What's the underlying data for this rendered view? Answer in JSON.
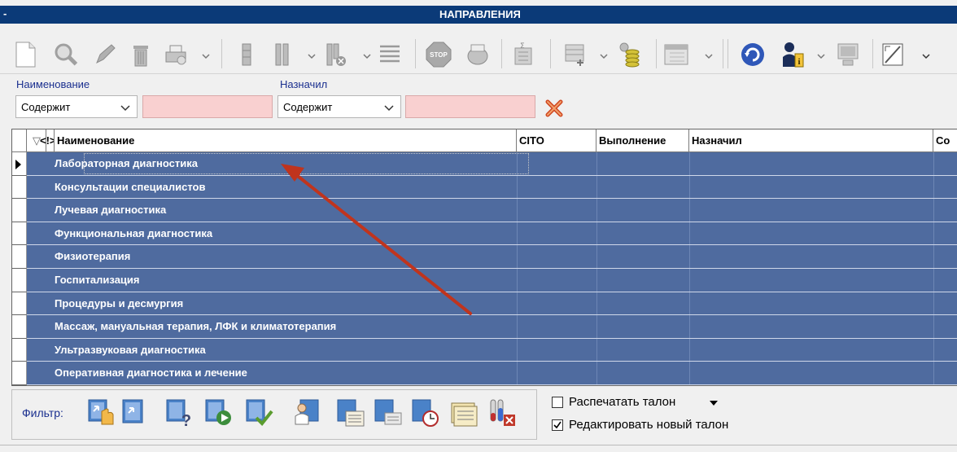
{
  "window": {
    "title": "НАПРАВЛЕНИЯ",
    "dash": "-"
  },
  "toolbar": {
    "buttons": [
      "new-icon",
      "search-icon",
      "edit-icon",
      "delete-icon",
      "print-icon",
      "column-icon",
      "columns-icon",
      "columns-cancel-icon",
      "list-icon",
      "stop-icon",
      "export-icon",
      "sum-icon",
      "add-row-icon",
      "coins-icon",
      "calendar-icon",
      "refresh-icon",
      "user-info-icon",
      "monitor-icon",
      "frame-icon"
    ]
  },
  "filters": {
    "name_label": "Наименование",
    "assigned_label": "Назначил",
    "name_mode": "Содержит",
    "assigned_mode": "Содержит",
    "name_value": "",
    "assigned_value": ""
  },
  "grid": {
    "columns": [
      "Наименование",
      "CITO",
      "Выполнение",
      "Назначил",
      "Со"
    ],
    "sort_marker": "▽",
    "expand_marker": "<!>",
    "rows": [
      "Лабораторная диагностика",
      "Консультации специалистов",
      "Лучевая диагностика",
      "Функциональная диагностика",
      "Физиотерапия",
      "Госпитализация",
      "Процедуры и десмургия",
      "Массаж, мануальная терапия, ЛФК и климатотерапия",
      "Ультразвуковая диагностика",
      "Оперативная диагностика и лечение"
    ],
    "selected_row": 0
  },
  "bottom": {
    "filter_label": "Фильтр:",
    "print_ticket_label": "Распечатать талон",
    "print_ticket_checked": false,
    "edit_ticket_label": "Редактировать новый талон",
    "edit_ticket_checked": true
  },
  "colors": {
    "title_bar": "#0b3a78",
    "row_fill": "#4f6b9f",
    "input_pink": "#f9d0d0",
    "annotation_arrow": "#c0341d"
  }
}
